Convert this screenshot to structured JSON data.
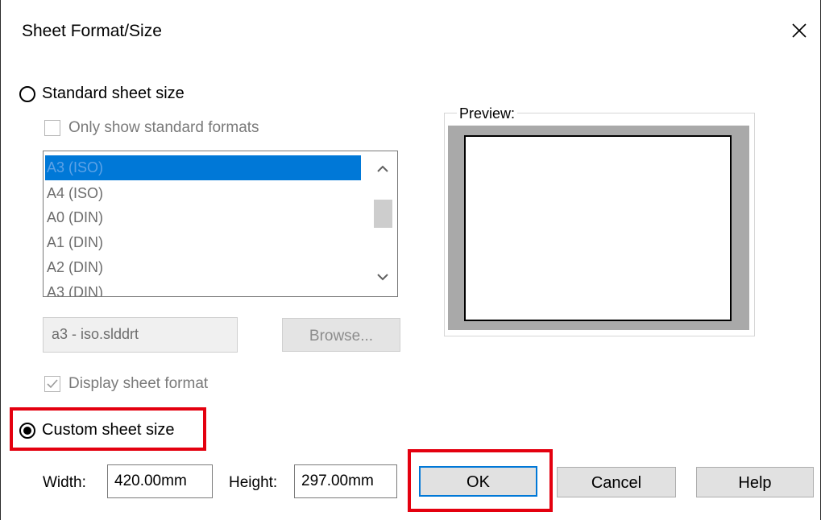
{
  "dialog": {
    "title": "Sheet Format/Size"
  },
  "standard": {
    "radio_label": "Standard sheet size",
    "selected": false,
    "only_standard_label": "Only show standard formats",
    "only_standard_checked": false,
    "list_items": [
      "A3 (ISO)",
      "A4 (ISO)",
      "A0 (DIN)",
      "A1 (DIN)",
      "A2 (DIN)",
      "A3 (DIN)"
    ],
    "selected_item": "A3 (ISO)",
    "format_file": "a3 - iso.slddrt",
    "browse_label": "Browse...",
    "display_format_label": "Display sheet format",
    "display_format_checked": true
  },
  "preview": {
    "label": "Preview:"
  },
  "custom": {
    "radio_label": "Custom sheet size",
    "selected": true,
    "width_label": "Width:",
    "width_value": "420.00mm",
    "height_label": "Height:",
    "height_value": "297.00mm"
  },
  "buttons": {
    "ok_label": "OK",
    "cancel_label": "Cancel",
    "help_label": "Help"
  },
  "colors": {
    "selection": "#0078d7",
    "highlight": "#e4000f",
    "disabled_text": "#7a7a7a"
  }
}
